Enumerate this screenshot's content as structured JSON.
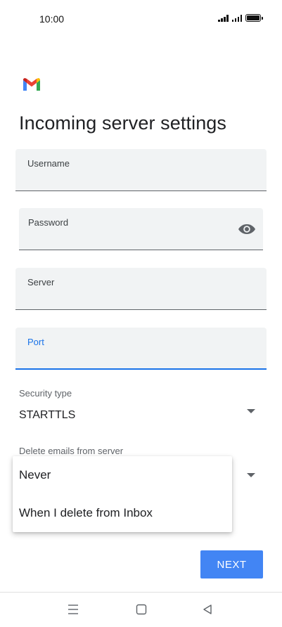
{
  "status_bar": {
    "time": "10:00",
    "signal_icons": [
      "signal-icon",
      "signal-icon"
    ],
    "battery_icon": "battery-icon"
  },
  "header": {
    "logo": "gmail-logo",
    "title": "Incoming server settings"
  },
  "form": {
    "username": {
      "label": "Username",
      "value": ""
    },
    "password": {
      "label": "Password",
      "value": "",
      "toggle_icon": "eye-icon"
    },
    "server": {
      "label": "Server",
      "value": ""
    },
    "port": {
      "label": "Port",
      "value": "",
      "focused": true,
      "accent": "#1a73e8"
    },
    "security_type": {
      "label": "Security type",
      "value": "STARTTLS"
    },
    "delete_emails": {
      "label": "Delete emails from server",
      "options": [
        "Never",
        "When I delete from Inbox"
      ]
    }
  },
  "actions": {
    "next_label": "NEXT",
    "next_color": "#4285f4"
  },
  "nav_bar": {
    "buttons": [
      "menu-icon",
      "home-icon",
      "back-icon"
    ]
  }
}
